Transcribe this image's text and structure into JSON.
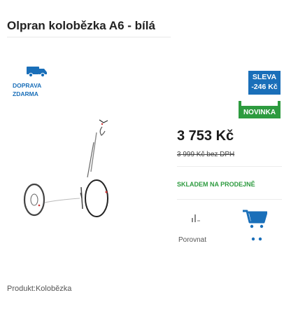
{
  "product": {
    "title": "Olpran kolobězka A6 - bílá",
    "price": "3 753 Kč",
    "old_price": "3 999 Kč bez DPH",
    "stock": "SKLADEM NA PRODEJNĚ"
  },
  "shipping": {
    "label_line1": "DOPRAVA",
    "label_line2": "ZDARMA",
    "icon": "truck-icon"
  },
  "badges": {
    "sale_line1": "SLEVA",
    "sale_line2": "-246 Kč",
    "new": "NOVINKA"
  },
  "actions": {
    "compare_label": "Porovnat",
    "compare_icon": "bar-chart-icon",
    "cart_icon": "cart-icon"
  },
  "breadcrumb": {
    "text": "Produkt:Kolobězka"
  },
  "colors": {
    "brand_blue": "#1a6fb9",
    "green": "#2d9b3f"
  }
}
